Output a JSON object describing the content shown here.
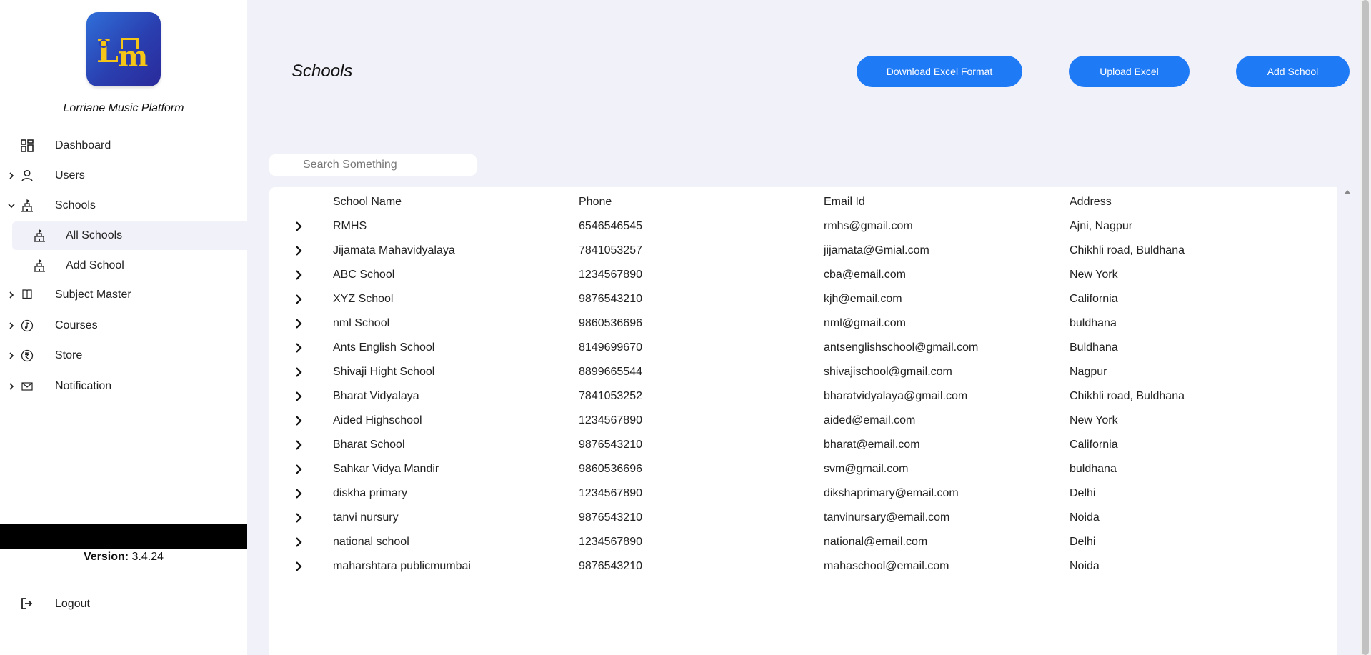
{
  "sidebar": {
    "brand": "Lorriane Music Platform",
    "items": [
      {
        "label": "Dashboard"
      },
      {
        "label": "Users"
      },
      {
        "label": "Schools"
      },
      {
        "label": "Subject Master"
      },
      {
        "label": "Courses"
      },
      {
        "label": "Store"
      },
      {
        "label": "Notification"
      }
    ],
    "schools_sub": [
      {
        "label": "All Schools"
      },
      {
        "label": "Add School"
      }
    ],
    "version_label": "Version:",
    "version_value": "3.4.24",
    "logout": "Logout"
  },
  "main": {
    "title": "Schools",
    "buttons": {
      "download": "Download Excel Format",
      "upload": "Upload Excel",
      "add": "Add School"
    },
    "search_placeholder": "Search Something",
    "columns": [
      "School Name",
      "Phone",
      "Email Id",
      "Address"
    ],
    "rows": [
      [
        "RMHS",
        "6546546545",
        "rmhs@gmail.com",
        "Ajni, Nagpur"
      ],
      [
        "Jijamata Mahavidyalaya",
        "7841053257",
        "jijamata@Gmial.com",
        "Chikhli road, Buldhana"
      ],
      [
        "ABC School",
        "1234567890",
        "cba@email.com",
        "New York"
      ],
      [
        "XYZ School",
        "9876543210",
        "kjh@email.com",
        "California"
      ],
      [
        "nml School",
        "9860536696",
        "nml@gmail.com",
        "buldhana"
      ],
      [
        "Ants English School",
        "8149699670",
        "antsenglishschool@gmail.com",
        "Buldhana"
      ],
      [
        "Shivaji Hight School",
        "8899665544",
        "shivajischool@gmail.com",
        "Nagpur"
      ],
      [
        "Bharat Vidyalaya",
        "7841053252",
        "bharatvidyalaya@gmail.com",
        "Chikhli road, Buldhana"
      ],
      [
        "Aided Highschool",
        "1234567890",
        "aided@email.com",
        "New York"
      ],
      [
        "Bharat School",
        "9876543210",
        "bharat@email.com",
        "California"
      ],
      [
        "Sahkar Vidya Mandir",
        "9860536696",
        "svm@gmail.com",
        "buldhana"
      ],
      [
        "diskha primary",
        "1234567890",
        "dikshaprimary@email.com",
        "Delhi"
      ],
      [
        "tanvi nursury",
        "9876543210",
        "tanvinursary@email.com",
        "Noida"
      ],
      [
        "national school",
        "1234567890",
        "national@email.com",
        "Delhi"
      ],
      [
        "maharshtara publicmumbai",
        "9876543210",
        "mahaschool@email.com",
        "Noida"
      ]
    ]
  },
  "colors": {
    "accent": "#1f7af5",
    "background": "#f1f1f9",
    "logo_gradient_start": "#2f6fd9",
    "logo_gradient_end": "#2a2a9a",
    "logo_glyph": "#f5c518"
  },
  "icons": {
    "dashboard": "dashboard-grid-icon",
    "users": "user-icon",
    "schools": "school-building-icon",
    "subject_master": "book-icon",
    "courses": "music-note-icon",
    "store": "rupee-icon",
    "notification": "envelope-icon",
    "logout": "logout-icon",
    "expand": "chevron-right-icon"
  }
}
